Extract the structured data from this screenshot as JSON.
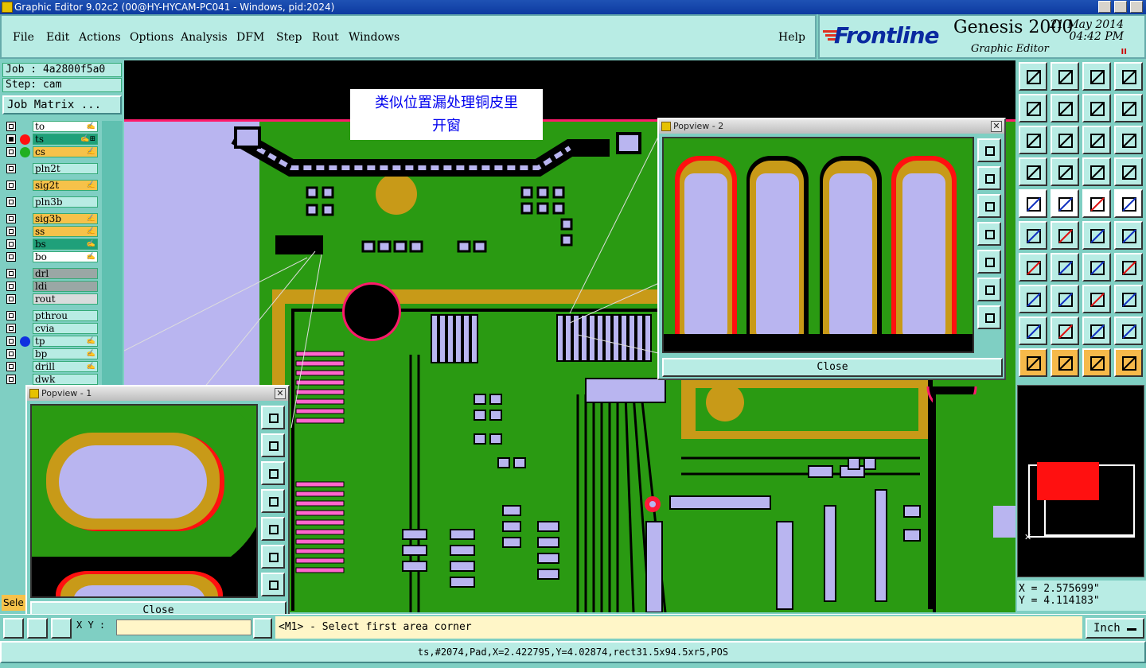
{
  "window": {
    "title": "Graphic Editor 9.02c2 (00@HY-HYCAM-PC041 - Windows, pid:2024)"
  },
  "menu": {
    "items": [
      "File",
      "Edit",
      "Actions",
      "Options",
      "Analysis",
      "DFM",
      "Step",
      "Rout",
      "Windows"
    ],
    "help": "Help"
  },
  "brand": {
    "logo": "Frontline",
    "product": "Genesis 2000",
    "subtitle": "Graphic Editor",
    "date": "21 May 2014",
    "time": "04:42 PM",
    "pause": "II"
  },
  "job": {
    "job": "Job : 4a2800f5a0",
    "step": "Step: cam",
    "matrix": "Job Matrix ..."
  },
  "layers": [
    {
      "name": "to",
      "color": "#ffffff",
      "dot": "",
      "mark": "✍"
    },
    {
      "name": "ts",
      "color": "#1fa07a",
      "dot": "#ff1010",
      "mark": "✍⊞"
    },
    {
      "name": "cs",
      "color": "#f6c24a",
      "dot": "#20b020",
      "mark": "✍"
    },
    {
      "name": "pln2t",
      "color": "#b8ece4",
      "dot": "",
      "mark": ""
    },
    {
      "name": "sig2t",
      "color": "#f6c24a",
      "dot": "",
      "mark": "✍"
    },
    {
      "name": "pln3b",
      "color": "#b8ece4",
      "dot": "",
      "mark": ""
    },
    {
      "name": "sig3b",
      "color": "#f6c24a",
      "dot": "",
      "mark": "✍"
    },
    {
      "name": "ss",
      "color": "#f6c24a",
      "dot": "",
      "mark": "✍"
    },
    {
      "name": "bs",
      "color": "#1fa07a",
      "dot": "",
      "mark": "✍"
    },
    {
      "name": "bo",
      "color": "#ffffff",
      "dot": "",
      "mark": "✍"
    },
    {
      "name": "drl",
      "color": "#9aa7a5",
      "dot": "",
      "mark": ""
    },
    {
      "name": "ldi",
      "color": "#9aa7a5",
      "dot": "",
      "mark": ""
    },
    {
      "name": "rout",
      "color": "#d8dcdc",
      "dot": "",
      "mark": ""
    },
    {
      "name": "pthrou",
      "color": "#b8ece4",
      "dot": "",
      "mark": ""
    },
    {
      "name": "cvia",
      "color": "#b8ece4",
      "dot": "",
      "mark": ""
    },
    {
      "name": "tp",
      "color": "#b8ece4",
      "dot": "#1030e0",
      "mark": "✍"
    },
    {
      "name": "bp",
      "color": "#b8ece4",
      "dot": "",
      "mark": "✍"
    },
    {
      "name": "drill",
      "color": "#b8ece4",
      "dot": "",
      "mark": "✍"
    },
    {
      "name": "dwk",
      "color": "#b8ece4",
      "dot": "",
      "mark": ""
    }
  ],
  "sel_label": "Sele",
  "annotation": {
    "line1": "类似位置漏处理铜皮里",
    "line2": "开窗"
  },
  "popview1": {
    "title": "Popview - 1",
    "close": "Close"
  },
  "popview2": {
    "title": "Popview - 2",
    "close": "Close"
  },
  "coords": {
    "x": "X = 2.575699\"",
    "y": "Y = 4.114183\""
  },
  "command": {
    "xy_label": "X Y :",
    "xy_value": "",
    "prompt": "<M1> - Select first area corner",
    "unit": "Inch"
  },
  "status": "ts,#2074,Pad,X=2.422795,Y=4.02874,rect31.5x94.5xr5,POS",
  "colors": {
    "board": "#2a9a12",
    "copper": "#c89a18",
    "pad": "#b9b5f0",
    "outline": "#ff1a3a"
  }
}
